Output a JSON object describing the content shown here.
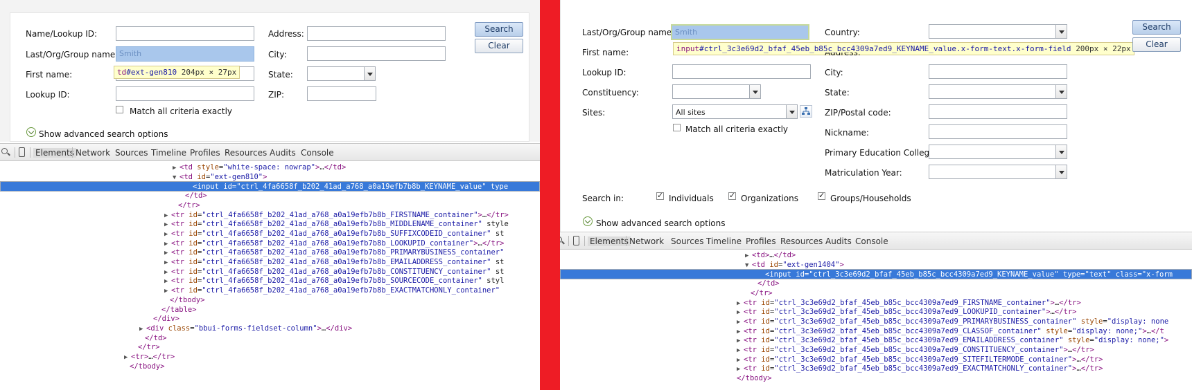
{
  "left": {
    "form": {
      "name_lookup_label": "Name/Lookup ID:",
      "last_org_group_label": "Last/Org/Group name:",
      "last_org_group_value": "Smith",
      "first_name_label": "First name:",
      "lookup_id_label": "Lookup ID:",
      "address_label": "Address:",
      "city_label": "City:",
      "state_label": "State:",
      "zip_label": "ZIP:",
      "match_all_label": "Match all criteria exactly",
      "advanced_label": "Show advanced search options",
      "search_button": "Search",
      "clear_button": "Clear"
    },
    "tooltip": {
      "tag": "td",
      "selector": "#ext-gen810",
      "dims": "204px × 27px"
    },
    "devtools": {
      "tabs": [
        "Elements",
        "Network",
        "Sources",
        "Timeline",
        "Profiles",
        "Resources",
        "Audits",
        "Console"
      ],
      "lines": [
        {
          "indent": 260,
          "arrow": "▶",
          "text": "<td style=\"white-space: nowrap\">…</td>"
        },
        {
          "indent": 260,
          "arrow": "▼",
          "text": "<td id=\"ext-gen810\">"
        },
        {
          "indent": 278,
          "arrow": "",
          "text": "<input id=\"ctrl_4fa6658f_b202_41ad_a768_a0a19efb7b8b_KEYNAME_value\" type",
          "selected": true
        },
        {
          "indent": 268,
          "arrow": "",
          "text": "</td>"
        },
        {
          "indent": 258,
          "arrow": "",
          "text": "</tr>"
        },
        {
          "indent": 248,
          "arrow": "▶",
          "text": "<tr id=\"ctrl_4fa6658f_b202_41ad_a768_a0a19efb7b8b_FIRSTNAME_container\">…</tr>"
        },
        {
          "indent": 248,
          "arrow": "▶",
          "text": "<tr id=\"ctrl_4fa6658f_b202_41ad_a768_a0a19efb7b8b_MIDDLENAME_container\" style"
        },
        {
          "indent": 248,
          "arrow": "▶",
          "text": "<tr id=\"ctrl_4fa6658f_b202_41ad_a768_a0a19efb7b8b_SUFFIXCODEID_container\" st"
        },
        {
          "indent": 248,
          "arrow": "▶",
          "text": "<tr id=\"ctrl_4fa6658f_b202_41ad_a768_a0a19efb7b8b_LOOKUPID_container\">…</tr>"
        },
        {
          "indent": 248,
          "arrow": "▶",
          "text": "<tr id=\"ctrl_4fa6658f_b202_41ad_a768_a0a19efb7b8b_PRIMARYBUSINESS_container\""
        },
        {
          "indent": 248,
          "arrow": "▶",
          "text": "<tr id=\"ctrl_4fa6658f_b202_41ad_a768_a0a19efb7b8b_EMAILADDRESS_container\" st"
        },
        {
          "indent": 248,
          "arrow": "▶",
          "text": "<tr id=\"ctrl_4fa6658f_b202_41ad_a768_a0a19efb7b8b_CONSTITUENCY_container\" st"
        },
        {
          "indent": 248,
          "arrow": "▶",
          "text": "<tr id=\"ctrl_4fa6658f_b202_41ad_a768_a0a19efb7b8b_SOURCECODE_container\" styl"
        },
        {
          "indent": 248,
          "arrow": "▶",
          "text": "<tr id=\"ctrl_4fa6658f_b202_41ad_a768_a0a19efb7b8b_EXACTMATCHONLY_container\""
        },
        {
          "indent": 246,
          "arrow": "",
          "text": "</tbody>"
        },
        {
          "indent": 234,
          "arrow": "",
          "text": "</table>"
        },
        {
          "indent": 222,
          "arrow": "",
          "text": "</div>"
        },
        {
          "indent": 212,
          "arrow": "▶",
          "text": "<div class=\"bbui-forms-fieldset-column\">…</div>"
        },
        {
          "indent": 210,
          "arrow": "",
          "text": "</td>"
        },
        {
          "indent": 200,
          "arrow": "",
          "text": "</tr>"
        },
        {
          "indent": 190,
          "arrow": "▶",
          "text": "<tr>…</tr>"
        },
        {
          "indent": 188,
          "arrow": "",
          "text": "</tbody>"
        }
      ]
    }
  },
  "right": {
    "form": {
      "last_org_group_label": "Last/Org/Group name:",
      "last_org_group_value": "Smith",
      "first_name_label": "First name:",
      "lookup_id_label": "Lookup ID:",
      "constituency_label": "Constituency:",
      "sites_label": "Sites:",
      "sites_value": "All sites",
      "match_all_label": "Match all criteria exactly",
      "country_label": "Country:",
      "address_label": "Address:",
      "city_label": "City:",
      "state_label": "State:",
      "zip_label": "ZIP/Postal code:",
      "nickname_label": "Nickname:",
      "primary_college_label": "Primary Education College:",
      "matriculation_label": "Matriculation Year:",
      "search_in_label": "Search in:",
      "individuals_label": "Individuals",
      "organizations_label": "Organizations",
      "groups_label": "Groups/Households",
      "advanced_label": "Show advanced search options",
      "search_button": "Search",
      "clear_button": "Clear"
    },
    "tooltip": {
      "tag": "input",
      "selector": "#ctrl_3c3e69d2_bfaf_45eb_b85c_bcc4309a7ed9_KEYNAME_value.x-form-text.x-form-field",
      "dims": "200px × 22px"
    },
    "devtools": {
      "tabs": [
        "Elements",
        "Network",
        "Sources",
        "Timeline",
        "Profiles",
        "Resources",
        "Audits",
        "Console"
      ],
      "lines": [
        {
          "indent": 1086,
          "arrow": "▶",
          "text": "<td>…</td>"
        },
        {
          "indent": 1086,
          "arrow": "▼",
          "text": "<td id=\"ext-gen1404\">"
        },
        {
          "indent": 1104,
          "arrow": "",
          "text": "<input id=\"ctrl_3c3e69d2_bfaf_45eb_b85c_bcc4309a7ed9_KEYNAME_value\" type=\"text\" class=\"x-form",
          "selected": true
        },
        {
          "indent": 1094,
          "arrow": "",
          "text": "</td>"
        },
        {
          "indent": 1084,
          "arrow": "",
          "text": "</tr>"
        },
        {
          "indent": 1074,
          "arrow": "▶",
          "text": "<tr id=\"ctrl_3c3e69d2_bfaf_45eb_b85c_bcc4309a7ed9_FIRSTNAME_container\">…</tr>"
        },
        {
          "indent": 1074,
          "arrow": "▶",
          "text": "<tr id=\"ctrl_3c3e69d2_bfaf_45eb_b85c_bcc4309a7ed9_LOOKUPID_container\">…</tr>"
        },
        {
          "indent": 1074,
          "arrow": "▶",
          "text": "<tr id=\"ctrl_3c3e69d2_bfaf_45eb_b85c_bcc4309a7ed9_PRIMARYBUSINESS_container\" style=\"display: none"
        },
        {
          "indent": 1074,
          "arrow": "▶",
          "text": "<tr id=\"ctrl_3c3e69d2_bfaf_45eb_b85c_bcc4309a7ed9_CLASSOF_container\" style=\"display: none;\">…</t"
        },
        {
          "indent": 1074,
          "arrow": "▶",
          "text": "<tr id=\"ctrl_3c3e69d2_bfaf_45eb_b85c_bcc4309a7ed9_EMAILADDRESS_container\" style=\"display: none;\">"
        },
        {
          "indent": 1074,
          "arrow": "▶",
          "text": "<tr id=\"ctrl_3c3e69d2_bfaf_45eb_b85c_bcc4309a7ed9_CONSTITUENCY_container\">…</tr>"
        },
        {
          "indent": 1074,
          "arrow": "▶",
          "text": "<tr id=\"ctrl_3c3e69d2_bfaf_45eb_b85c_bcc4309a7ed9_SITEFILTERMODE_container\">…</tr>"
        },
        {
          "indent": 1074,
          "arrow": "▶",
          "text": "<tr id=\"ctrl_3c3e69d2_bfaf_45eb_b85c_bcc4309a7ed9_EXACTMATCHONLY_container\">…</tr>"
        },
        {
          "indent": 1064,
          "arrow": "",
          "text": "</tbody>"
        }
      ]
    }
  },
  "colors": {
    "divider": "#ee1c25",
    "selected_row": "#3879d9",
    "highlight_input": "#a9c7ec",
    "tooltip_bg": "#ffffcc"
  }
}
